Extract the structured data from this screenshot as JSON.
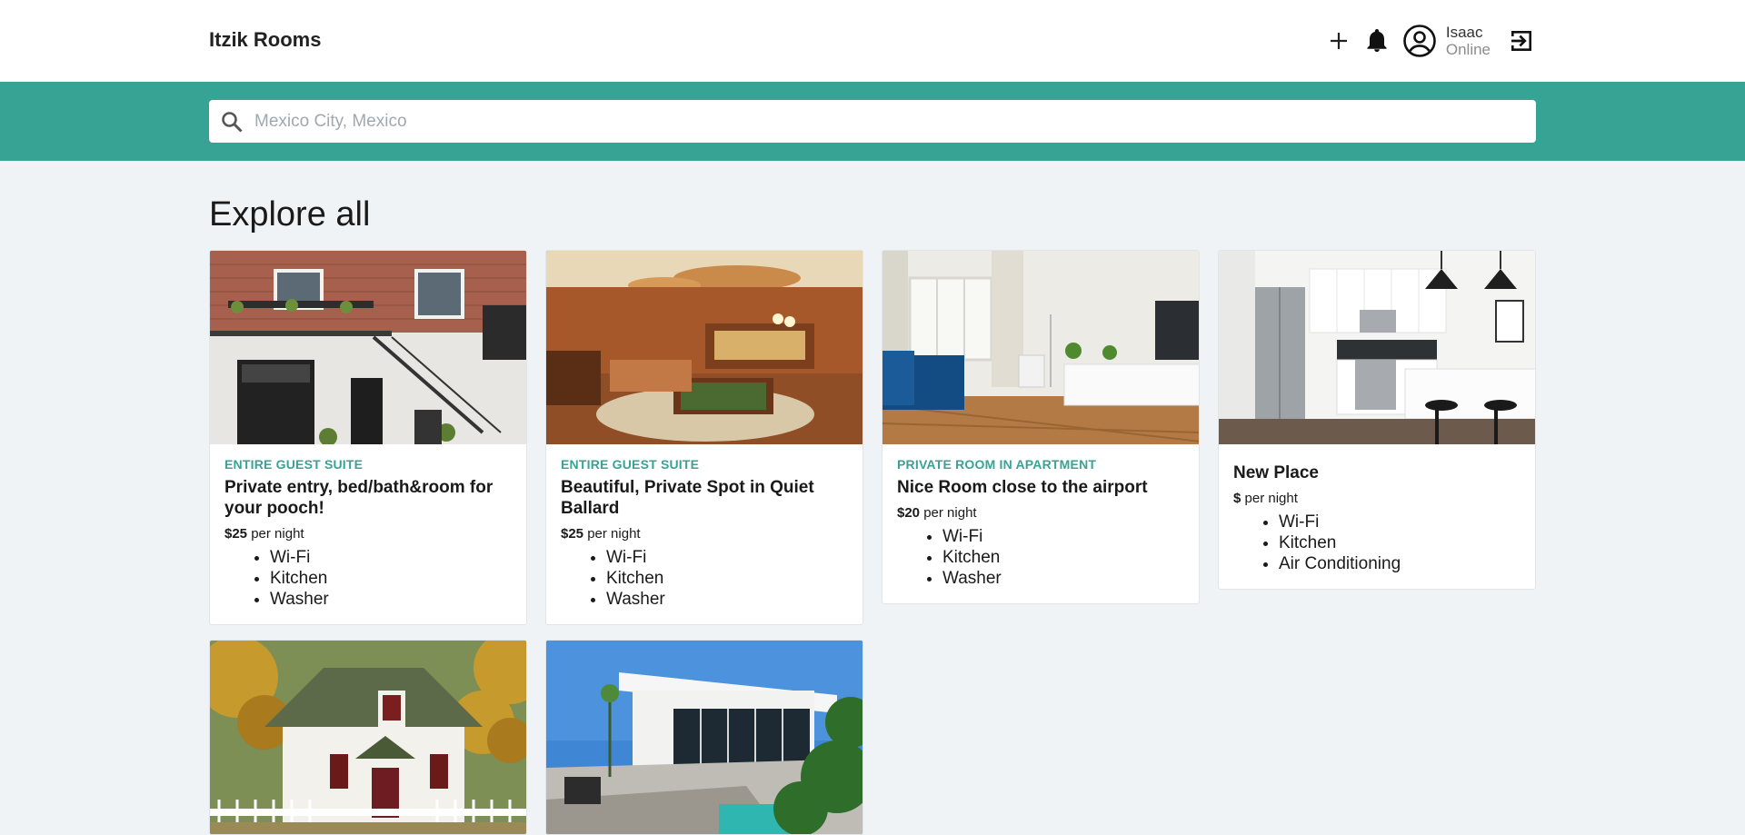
{
  "header": {
    "brand": "Itzik Rooms",
    "user_name": "Isaac",
    "user_status": "Online",
    "icons": [
      "add-icon",
      "bell-icon",
      "account-circle-icon",
      "logout-icon"
    ]
  },
  "search": {
    "placeholder": "Mexico City, Mexico",
    "value": ""
  },
  "main": {
    "title": "Explore all"
  },
  "listings": [
    {
      "type": "ENTIRE GUEST SUITE",
      "title": "Private entry, bed/bath&room for your pooch!",
      "price": "$25",
      "per": "per night",
      "amenities": [
        "Wi-Fi",
        "Kitchen",
        "Washer"
      ]
    },
    {
      "type": "ENTIRE GUEST SUITE",
      "title": "Beautiful, Private Spot in Quiet Ballard",
      "price": "$25",
      "per": "per night",
      "amenities": [
        "Wi-Fi",
        "Kitchen",
        "Washer"
      ]
    },
    {
      "type": "PRIVATE ROOM IN APARTMENT",
      "title": "Nice Room close to the airport",
      "price": "$20",
      "per": "per night",
      "amenities": [
        "Wi-Fi",
        "Kitchen",
        "Washer"
      ]
    },
    {
      "type": "",
      "title": "New Place",
      "price": "$",
      "per": "per night",
      "amenities": [
        "Wi-Fi",
        "Kitchen",
        "Air Conditioning"
      ]
    },
    {
      "type": "",
      "title": "",
      "price": "",
      "per": "",
      "amenities": []
    },
    {
      "type": "",
      "title": "",
      "price": "",
      "per": "",
      "amenities": []
    }
  ],
  "colors": {
    "accent": "#37a395",
    "background": "#eff3f6"
  }
}
